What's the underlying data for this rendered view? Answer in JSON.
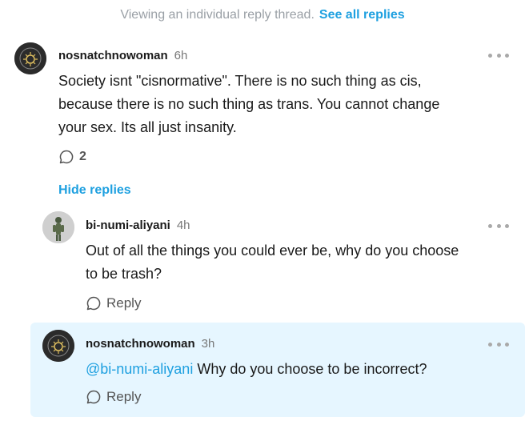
{
  "banner": {
    "text": "Viewing an individual reply thread.",
    "link": "See all replies"
  },
  "thread": {
    "top": {
      "username": "nosnatchnowoman",
      "time": "6h",
      "lines": [
        "Society isnt \"cisnormative\". There is no such thing as cis,",
        "because there is no such thing as trans. You cannot change",
        "your sex. Its all just insanity."
      ],
      "reply_count": "2",
      "hide_replies": "Hide replies"
    },
    "reply1": {
      "username": "bi-numi-aliyani",
      "time": "4h",
      "lines": [
        "Out of all the things you could ever be, why do you choose",
        "to be trash?"
      ],
      "reply_label": "Reply"
    },
    "reply2": {
      "username": "nosnatchnowoman",
      "time": "3h",
      "mention": "@bi-numi-aliyani",
      "text": " Why do you choose to be incorrect?",
      "reply_label": "Reply"
    }
  },
  "colors": {
    "accent": "#1ea0e0",
    "highlight_bg": "#e6f6ff"
  }
}
